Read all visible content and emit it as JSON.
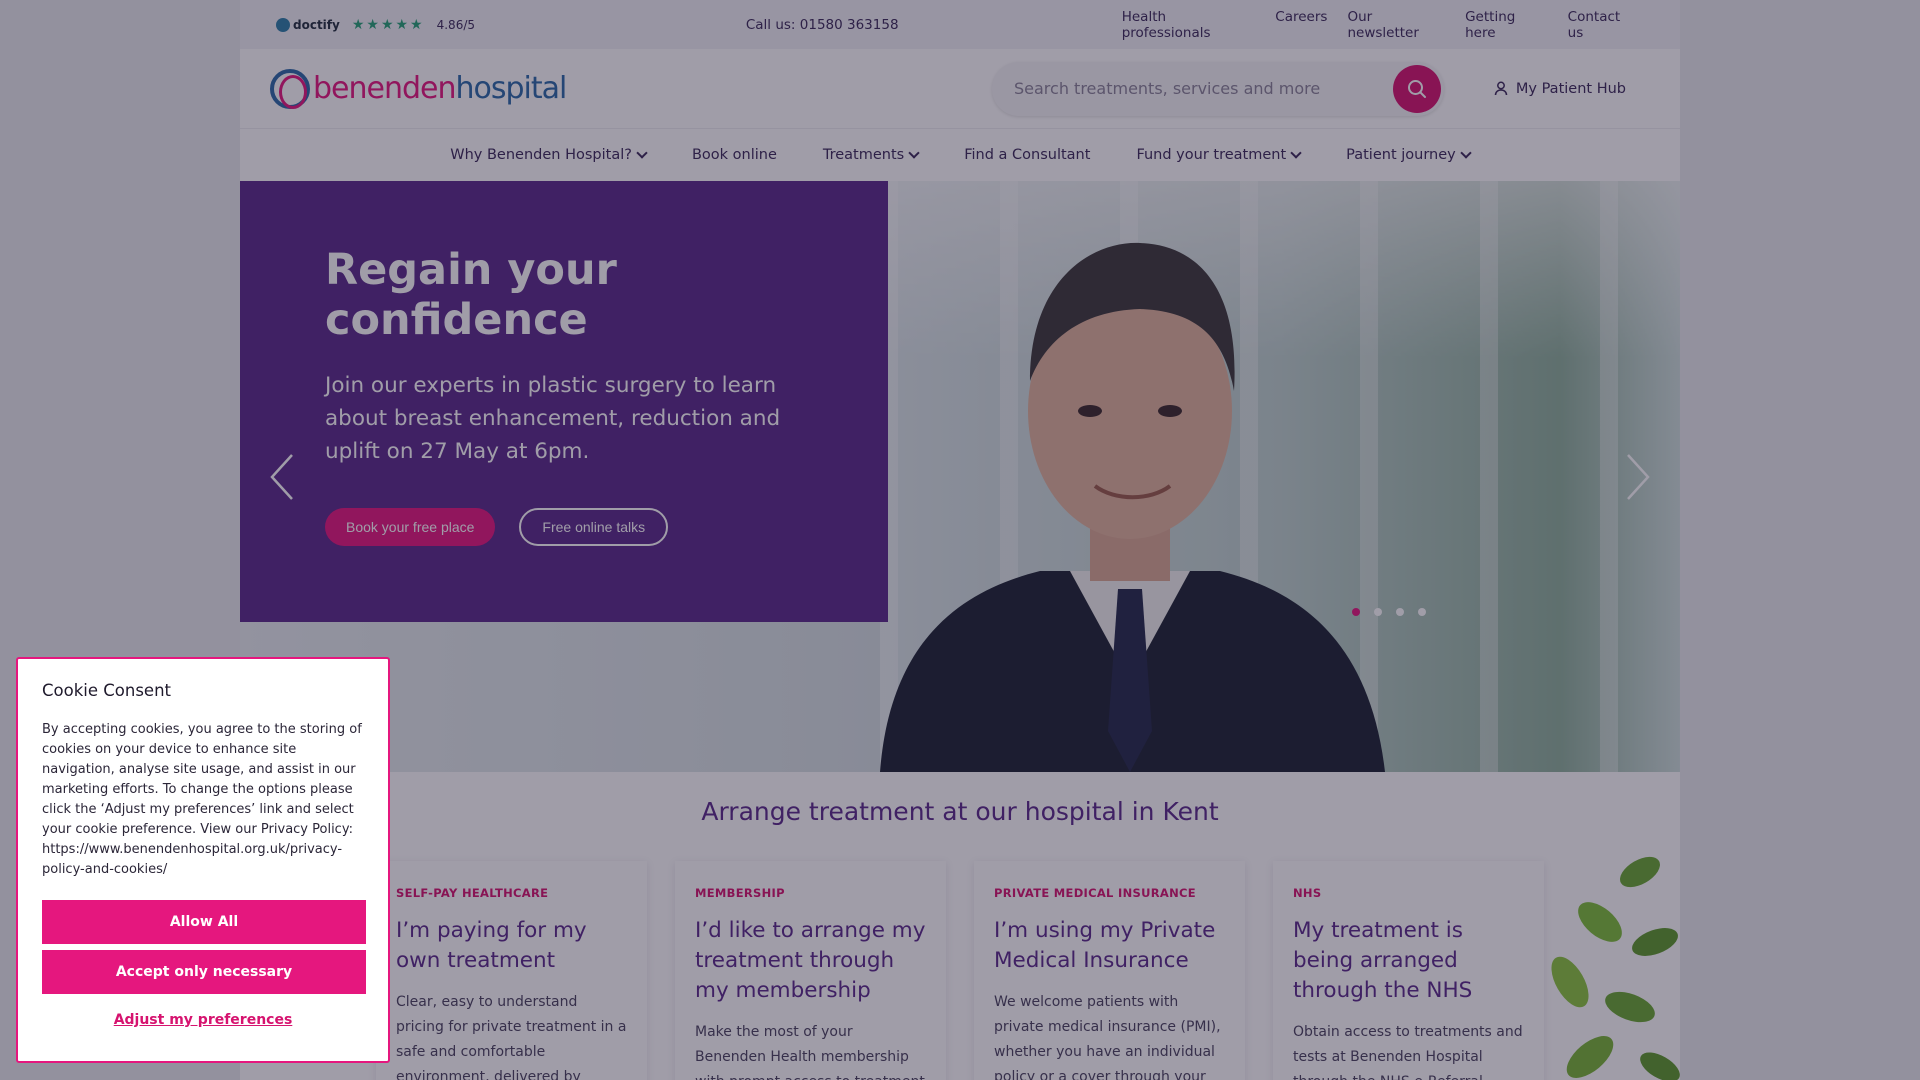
{
  "utility_bar": {
    "doctify_label": "doctify",
    "stars": "★★★★★",
    "rating": "4.86/5",
    "call": "Call us: 01580 363158",
    "links": [
      "Health professionals",
      "Careers",
      "Our newsletter",
      "Getting here",
      "Contact us"
    ]
  },
  "header": {
    "logo_part1": "benenden",
    "logo_part2": "hospital",
    "search_placeholder": "Search treatments, services and more",
    "patient_hub": "My Patient Hub"
  },
  "nav": {
    "items": [
      {
        "label": "Why Benenden Hospital?",
        "has_dropdown": true
      },
      {
        "label": "Book online",
        "has_dropdown": false
      },
      {
        "label": "Treatments",
        "has_dropdown": true
      },
      {
        "label": "Find a Consultant",
        "has_dropdown": false
      },
      {
        "label": "Fund your treatment",
        "has_dropdown": true
      },
      {
        "label": "Patient journey",
        "has_dropdown": true
      }
    ]
  },
  "hero": {
    "title": "Regain your confidence",
    "text": "Join our experts in plastic surgery to learn about breast enhancement, reduction and uplift on 27 May at 6pm.",
    "primary_cta": "Book your free place",
    "secondary_cta": "Free online talks",
    "slide_count": 4,
    "active_slide": 1
  },
  "arrange": {
    "title": "Arrange treatment at our hospital in Kent",
    "cards": [
      {
        "tag": "SELF-PAY HEALTHCARE",
        "title": "I’m paying for my own treatment",
        "text": "Clear, easy to understand pricing for private treatment in a safe and comfortable environment, delivered by experienced and"
      },
      {
        "tag": "MEMBERSHIP",
        "title": "I’d like to arrange my treatment through my membership",
        "text": "Make the most of your Benenden Health membership with prompt access to treatment and"
      },
      {
        "tag": "PRIVATE MEDICAL INSURANCE",
        "title": "I’m using my Private Medical Insurance",
        "text": "We welcome patients with private medical insurance (PMI), whether you have an individual policy or a cover through your job."
      },
      {
        "tag": "NHS",
        "title": "My treatment is being arranged through the NHS",
        "text": "Obtain access to treatments and tests at Benenden Hospital through the NHS e-Referral"
      }
    ]
  },
  "cookie": {
    "title": "Cookie Consent",
    "text": "By accepting cookies, you agree to the storing of cookies on your device to enhance site navigation, analyse site usage, and assist in our marketing efforts. To change the options please click the ‘Adjust my preferences’ link and select your cookie preference. View our Privacy Policy: https://www.benendenhospital.org.uk/privacy-policy-and-cookies/",
    "allow_all": "Allow All",
    "accept_necessary": "Accept only necessary",
    "adjust": "Adjust my preferences"
  },
  "colors": {
    "brand_pink": "#e5177e",
    "brand_purple": "#5a2a8a",
    "brand_blue": "#2b6aa8"
  }
}
